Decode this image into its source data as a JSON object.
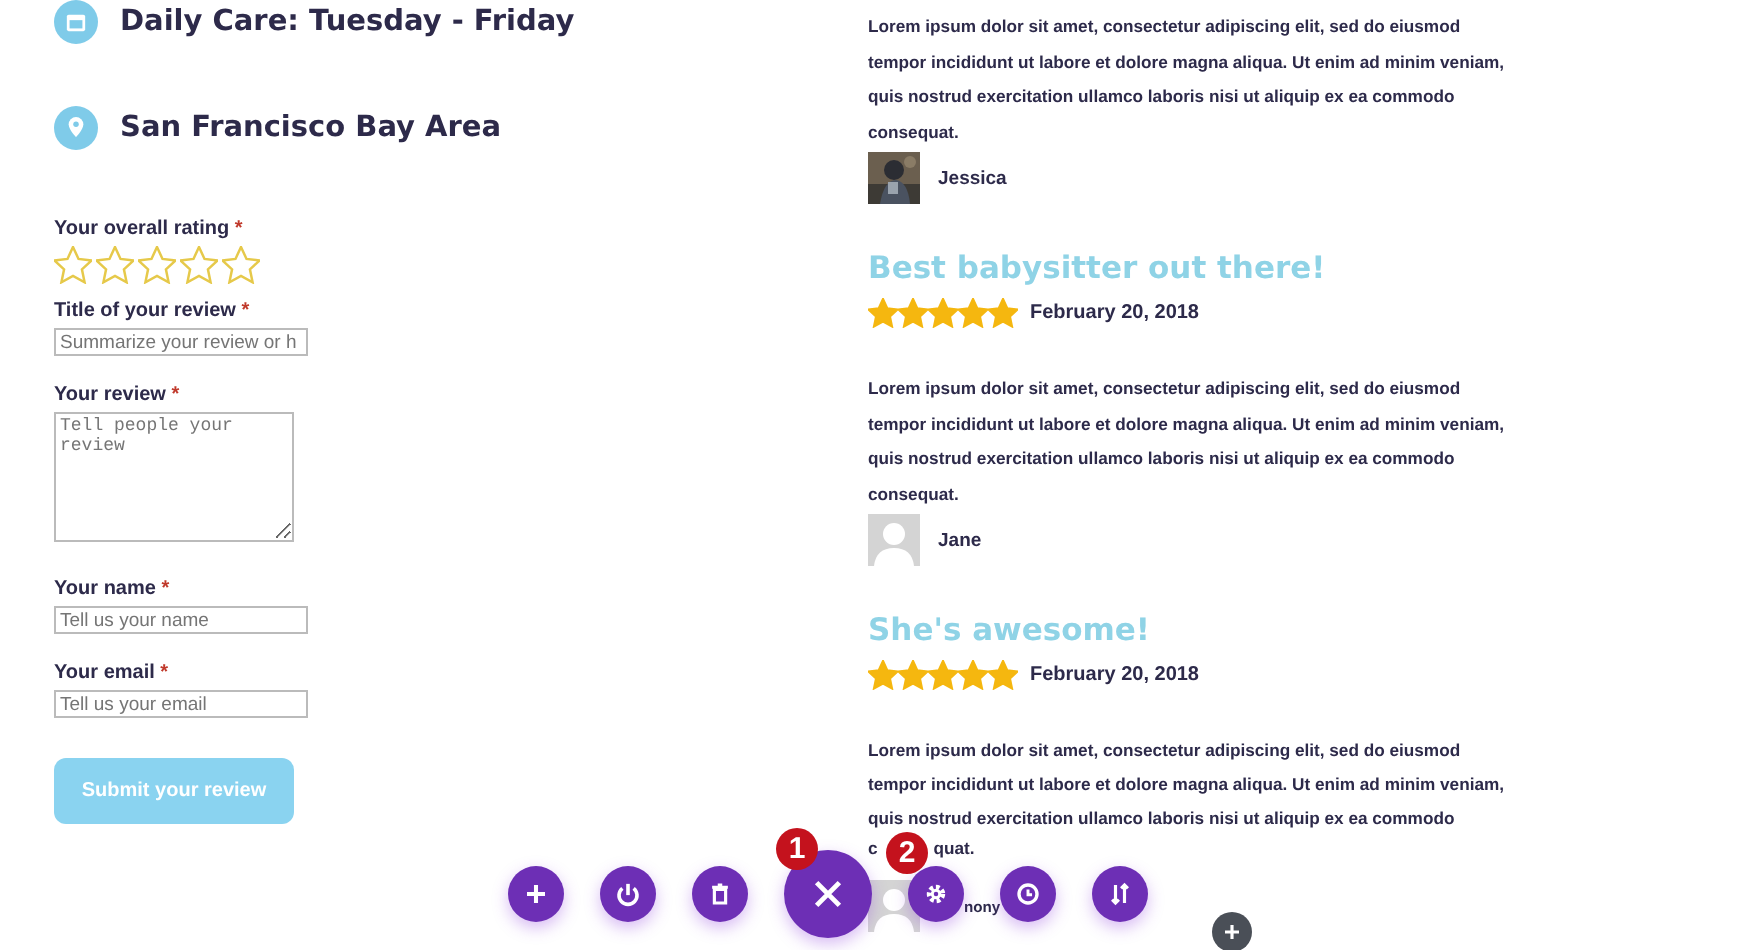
{
  "info": [
    {
      "kind": "calendar",
      "text": "Daily Care: Tuesday - Friday"
    },
    {
      "kind": "pin",
      "text": "San Francisco Bay Area"
    }
  ],
  "form": {
    "rating": {
      "label": "Your overall rating",
      "required": "*",
      "stars": 0
    },
    "fields": [
      {
        "kind": "input",
        "label": "Title of your review",
        "required": "*",
        "placeholder": "Summarize your review or h"
      },
      {
        "kind": "textarea",
        "label": "Your review",
        "required": "*",
        "placeholder": "Tell people your review"
      },
      {
        "kind": "input",
        "label": "Your name",
        "required": "*",
        "placeholder": "Tell us your name"
      },
      {
        "kind": "input",
        "label": "Your email",
        "required": "*",
        "placeholder": "Tell us your email"
      }
    ],
    "submit": "Submit your review"
  },
  "reviews": [
    {
      "body": "Lorem ipsum dolor sit amet, consectetur adipiscing elit, sed do eiusmod tempor incididunt ut labore et dolore magna aliqua. Ut enim ad minim veniam, quis nostrud exercitation ullamco laboris nisi ut aliquip ex ea commodo consequat.",
      "author": "Jessica"
    },
    {
      "title": "Best babysitter out there!",
      "stars": 5,
      "date": "February 20, 2018",
      "body": "Lorem ipsum dolor sit amet, consectetur adipiscing elit, sed do eiusmod tempor incididunt ut labore et dolore magna aliqua. Ut enim ad minim veniam, quis nostrud exercitation ullamco laboris nisi ut aliquip ex ea commodo consequat.",
      "author": "Jane",
      "avatar": {
        "kind": "default"
      }
    },
    {
      "title": "She's awesome!",
      "stars": 5,
      "date": "February 20, 2018",
      "body": "Lorem ipsum dolor sit amet, consectetur adipiscing elit, sed do eiusmod tempor incididunt ut labore et dolore magna aliqua. Ut enim ad minim veniam, quis nostrud exercitation ullamco laboris nisi ut aliquip ex ea commodo",
      "covered_line_parts": [
        "c",
        "quat."
      ],
      "author": "nony",
      "avatar": {
        "kind": "default"
      }
    }
  ],
  "toolbar": {
    "buttons": [
      {
        "kind": "add"
      },
      {
        "kind": "power"
      },
      {
        "kind": "trash"
      },
      {
        "kind": "close",
        "badge": "1"
      },
      {
        "kind": "settings",
        "badge": "2"
      },
      {
        "kind": "history"
      },
      {
        "kind": "sort"
      }
    ],
    "corner_button": {
      "kind": "add"
    }
  }
}
